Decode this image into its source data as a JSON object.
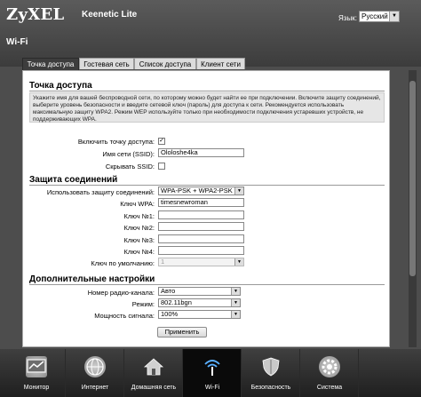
{
  "header": {
    "logo": "ZyXEL",
    "model": "Keenetic Lite",
    "language_label": "Язык:",
    "language_value": "Русский",
    "page_title": "Wi-Fi"
  },
  "tabs": [
    {
      "label": "Точка доступа"
    },
    {
      "label": "Гостевая сеть"
    },
    {
      "label": "Список доступа"
    },
    {
      "label": "Клиент сети"
    }
  ],
  "access_point": {
    "title": "Точка доступа",
    "info": "Укажите имя для вашей беспроводной сети, по которому можно будет найти ее при подключении. Включите защиту соединений, выберите уровень безопасности и введите сетевой ключ (пароль) для доступа к сети. Рекомендуется использовать максимальную защиту WPA2. Режим WEP используйте только при необходимости подключения устаревших устройств, не поддерживающих WPA.",
    "enable_label": "Включить точку доступа:",
    "enable_checked": true,
    "ssid_label": "Имя сети (SSID):",
    "ssid_value": "Ololoshe4ka",
    "hide_label": "Скрывать SSID:",
    "hide_checked": false
  },
  "security": {
    "title": "Защита соединений",
    "use_label": "Использовать защиту соединений:",
    "use_value": "WPA-PSK + WPA2-PSK",
    "wpa_label": "Ключ WPA:",
    "wpa_value": "timesnewroman",
    "key1_label": "Ключ №1:",
    "key2_label": "Ключ №2:",
    "key3_label": "Ключ №3:",
    "key4_label": "Ключ №4:",
    "default_label": "Ключ по умолчанию:",
    "default_value": "1"
  },
  "advanced": {
    "title": "Дополнительные настройки",
    "channel_label": "Номер радио-канала:",
    "channel_value": "Авто",
    "mode_label": "Режим:",
    "mode_value": "802.11bgn",
    "power_label": "Мощность сигнала:",
    "power_value": "100%",
    "apply_label": "Применить"
  },
  "nav": [
    {
      "label": "Монитор",
      "icon": "monitor-icon"
    },
    {
      "label": "Интернет",
      "icon": "globe-icon"
    },
    {
      "label": "Домашняя сеть",
      "icon": "home-icon"
    },
    {
      "label": "Wi-Fi",
      "icon": "wifi-icon"
    },
    {
      "label": "Безопасность",
      "icon": "shield-icon"
    },
    {
      "label": "Система",
      "icon": "gear-icon"
    }
  ]
}
